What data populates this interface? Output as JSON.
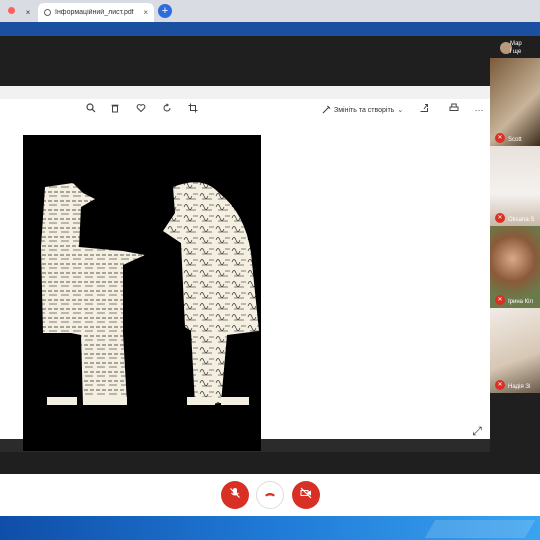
{
  "browser": {
    "active_tab_title": "Інформаційний_лист.pdf",
    "new_tab_label": "+"
  },
  "viewer": {
    "edit_create_label": "Змініть та створіть"
  },
  "participants": {
    "top": {
      "name_line1": "Мар",
      "name_line2": "і ще"
    },
    "tiles": [
      {
        "name": "Scott"
      },
      {
        "name": "Oksana S"
      },
      {
        "name": "Ірина Кіл"
      },
      {
        "name": "Надія Зі"
      }
    ]
  },
  "colors": {
    "meet_bg": "#1f1f1f",
    "danger": "#d93025",
    "taskbar": "#1f7ad6",
    "tab_blue": "#1b4f9f"
  },
  "icons": {
    "zoom": "zoom-icon",
    "trash": "trash-icon",
    "heart": "heart-icon",
    "rotate": "rotate-icon",
    "crop": "crop-icon",
    "edit": "magic-edit-icon",
    "share": "share-icon",
    "print": "print-icon",
    "more": "more-icon",
    "expand": "expand-icon",
    "mic_off": "mic-off-icon",
    "hangup": "hangup-icon",
    "cam_off": "camera-off-icon"
  }
}
